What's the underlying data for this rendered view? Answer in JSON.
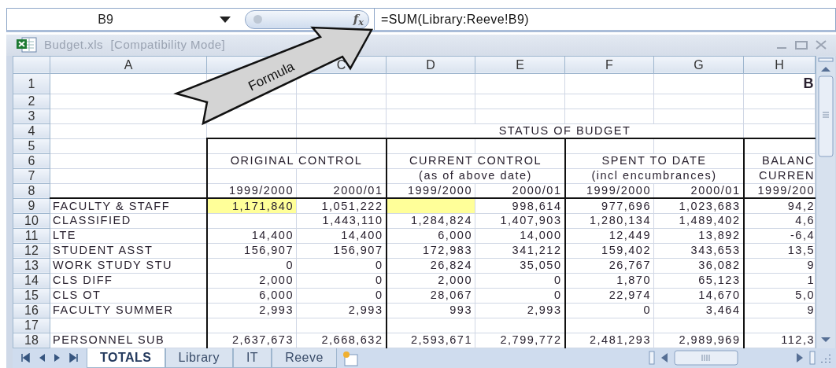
{
  "formula_bar": {
    "name_box": "B9",
    "function_label": "f$_{x}$",
    "formula": "=SUM(Library:Reeve!B9)"
  },
  "window": {
    "title": "Budget.xls  [Compatibility Mode]"
  },
  "callout": {
    "label": "Formula"
  },
  "columns": [
    {
      "label": "A"
    },
    {},
    {
      "label": "C"
    },
    {
      "label": "D"
    },
    {
      "label": "E"
    },
    {
      "label": "F"
    },
    {
      "label": "G"
    },
    {
      "label": "H"
    }
  ],
  "rows": [
    {
      "number": "1",
      "cells": {
        "H": {
          "text": "B",
          "bold": true
        }
      }
    },
    {
      "number": "2",
      "cells": {}
    },
    {
      "number": "3",
      "cells": {}
    },
    {
      "number": "4",
      "cells": {
        "D:G": {
          "text": "STATUS OF BUDGET"
        }
      }
    },
    {
      "number": "5",
      "cells": {}
    },
    {
      "number": "6",
      "cells": {
        "B:C": {
          "text": "ORIGINAL CONTROL"
        },
        "D:E": {
          "text": "CURRENT CONTROL"
        },
        "F:G": {
          "text": "SPENT TO DATE"
        },
        "H": {
          "text": "BALANC"
        }
      }
    },
    {
      "number": "7",
      "cells": {
        "D:E": {
          "text": "(as of above date)"
        },
        "F:G": {
          "text": "(incl encumbrances)"
        },
        "H": {
          "text": "CURREN"
        }
      }
    },
    {
      "number": "8",
      "cells": {
        "B": {
          "text": "1999/2000"
        },
        "C": {
          "text": "2000/01"
        },
        "D": {
          "text": "1999/2000"
        },
        "E": {
          "text": "2000/01"
        },
        "F": {
          "text": "1999/2000"
        },
        "G": {
          "text": "2000/01"
        },
        "H": {
          "text": "1999/200"
        }
      }
    },
    {
      "number": "9",
      "cells": {
        "A": {
          "text": "FACULTY & STAFF"
        },
        "B": {
          "text": "1,171,840",
          "color": "#ffff99"
        },
        "C": {
          "text": "1,051,222"
        },
        "D": {
          "color": "#ffff99"
        },
        "E": {
          "text": "998,614"
        },
        "F": {
          "text": "977,696"
        },
        "G": {
          "text": "1,023,683"
        },
        "H": {
          "text": "94,2"
        }
      }
    },
    {
      "number": "10",
      "cells": {
        "A": {
          "text": "CLASSIFIED"
        },
        "C": {
          "text": "1,443,110"
        },
        "D": {
          "text": "1,284,824"
        },
        "E": {
          "text": "1,407,903"
        },
        "F": {
          "text": "1,280,134"
        },
        "G": {
          "text": "1,489,402"
        },
        "H": {
          "text": "4,6"
        }
      }
    },
    {
      "number": "11",
      "cells": {
        "A": {
          "text": "LTE"
        },
        "B": {
          "text": "14,400"
        },
        "C": {
          "text": "14,400"
        },
        "D": {
          "text": "6,000"
        },
        "E": {
          "text": "14,000"
        },
        "F": {
          "text": "12,449"
        },
        "G": {
          "text": "13,892"
        },
        "H": {
          "text": "-6,4"
        }
      }
    },
    {
      "number": "12",
      "cells": {
        "A": {
          "text": "STUDENT ASST"
        },
        "B": {
          "text": "156,907"
        },
        "C": {
          "text": "156,907"
        },
        "D": {
          "text": "172,983"
        },
        "E": {
          "text": "341,212"
        },
        "F": {
          "text": "159,402"
        },
        "G": {
          "text": "343,653"
        },
        "H": {
          "text": "13,5"
        }
      }
    },
    {
      "number": "13",
      "cells": {
        "A": {
          "text": "WORK STUDY STU"
        },
        "B": {
          "text": "0"
        },
        "C": {
          "text": "0"
        },
        "D": {
          "text": "26,824"
        },
        "E": {
          "text": "35,050"
        },
        "F": {
          "text": "26,767"
        },
        "G": {
          "text": "36,082"
        },
        "H": {
          "text": "9"
        }
      }
    },
    {
      "number": "14",
      "cells": {
        "A": {
          "text": "CLS DIFF"
        },
        "B": {
          "text": "2,000"
        },
        "C": {
          "text": "0"
        },
        "D": {
          "text": "2,000"
        },
        "E": {
          "text": "0"
        },
        "F": {
          "text": "1,870"
        },
        "G": {
          "text": "65,123"
        },
        "H": {
          "text": "1"
        }
      }
    },
    {
      "number": "15",
      "cells": {
        "A": {
          "text": "CLS OT"
        },
        "B": {
          "text": "6,000"
        },
        "C": {
          "text": "0"
        },
        "D": {
          "text": "28,067"
        },
        "E": {
          "text": "0"
        },
        "F": {
          "text": "22,974"
        },
        "G": {
          "text": "14,670"
        },
        "H": {
          "text": "5,0"
        }
      }
    },
    {
      "number": "16",
      "cells": {
        "A": {
          "text": "FACULTY SUMMER"
        },
        "B": {
          "text": "2,993"
        },
        "C": {
          "text": "2,993"
        },
        "D": {
          "text": "993"
        },
        "E": {
          "text": "2,993"
        },
        "F": {
          "text": "0"
        },
        "G": {
          "text": "3,464"
        },
        "H": {
          "text": "9"
        }
      }
    },
    {
      "number": "17",
      "cells": {}
    },
    {
      "number": "18",
      "cells": {
        "A": {
          "text": "PERSONNEL SUB"
        },
        "B": {
          "text": "2,637,673"
        },
        "C": {
          "text": "2,668,632"
        },
        "D": {
          "text": "2,593,671"
        },
        "E": {
          "text": "2,799,772"
        },
        "F": {
          "text": "2,481,293"
        },
        "G": {
          "text": "2,989,969"
        },
        "H": {
          "text": "112,3"
        }
      }
    }
  ],
  "sheet_tabs": [
    {
      "label": "TOTALS",
      "selected": true
    },
    {
      "label": "Library",
      "selected": false
    },
    {
      "label": "IT",
      "selected": false
    },
    {
      "label": "Reeve",
      "selected": false
    }
  ]
}
